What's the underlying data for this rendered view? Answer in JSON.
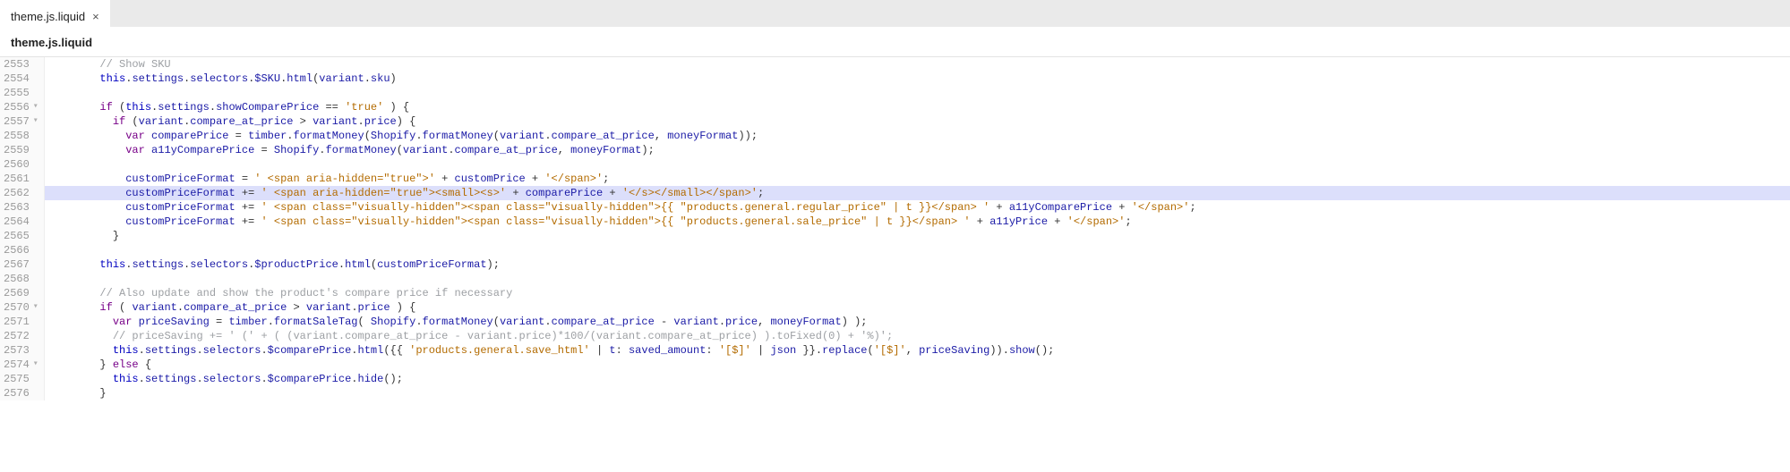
{
  "tab": {
    "title": "theme.js.liquid",
    "close": "×"
  },
  "breadcrumb": "theme.js.liquid",
  "gutter": {
    "start": 2553,
    "end": 2576,
    "fold_markers": [
      2556,
      2557,
      2570,
      2574
    ]
  },
  "highlighted_line": 2562,
  "code": {
    "2553": "        // Show SKU",
    "2554": "        this.settings.selectors.$SKU.html(variant.sku)",
    "2555": "",
    "2556": "        if (this.settings.showComparePrice == 'true' ) {",
    "2557": "          if (variant.compare_at_price > variant.price) {",
    "2558": "            var comparePrice = timber.formatMoney(Shopify.formatMoney(variant.compare_at_price, moneyFormat));",
    "2559": "            var a11yComparePrice = Shopify.formatMoney(variant.compare_at_price, moneyFormat);",
    "2560": "",
    "2561": "            customPriceFormat = ' <span aria-hidden=\"true\">' + customPrice + '</span>';",
    "2562": "            customPriceFormat += ' <span aria-hidden=\"true\"><small><s>' + comparePrice + '</s></small></span>';",
    "2563": "            customPriceFormat += ' <span class=\"visually-hidden\"><span class=\"visually-hidden\">{{ \"products.general.regular_price\" | t }}</span> ' + a11yComparePrice + '</span>';",
    "2564": "            customPriceFormat += ' <span class=\"visually-hidden\"><span class=\"visually-hidden\">{{ \"products.general.sale_price\" | t }}</span> ' + a11yPrice + '</span>';",
    "2565": "          }",
    "2566": "",
    "2567": "        this.settings.selectors.$productPrice.html(customPriceFormat);",
    "2568": "",
    "2569": "        // Also update and show the product's compare price if necessary",
    "2570": "        if ( variant.compare_at_price > variant.price ) {",
    "2571": "          var priceSaving = timber.formatSaleTag( Shopify.formatMoney(variant.compare_at_price - variant.price, moneyFormat) );",
    "2572": "          // priceSaving += ' (' + ( (variant.compare_at_price - variant.price)*100/(variant.compare_at_price) ).toFixed(0) + '%)';",
    "2573": "          this.settings.selectors.$comparePrice.html({{ 'products.general.save_html' | t: saved_amount: '[$]' | json }}.replace('[$]', priceSaving)).show();",
    "2574": "        } else {",
    "2575": "          this.settings.selectors.$comparePrice.hide();",
    "2576": "        }"
  }
}
